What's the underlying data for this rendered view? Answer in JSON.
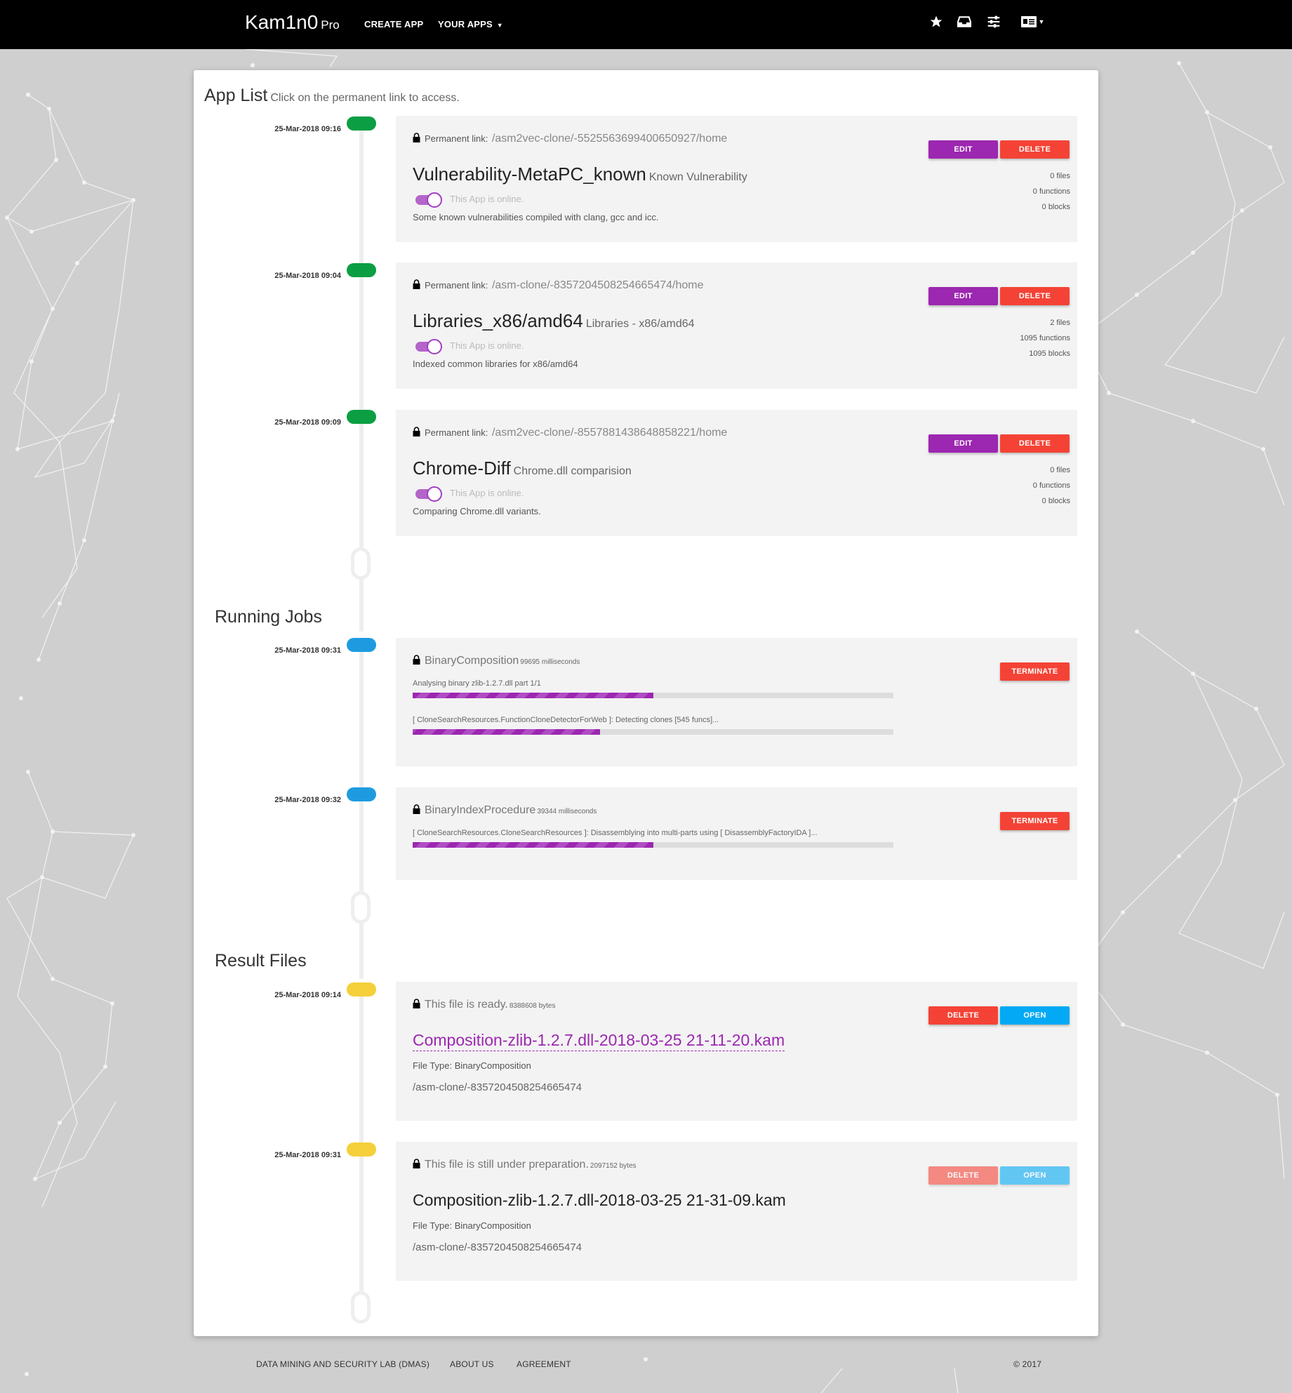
{
  "navbar": {
    "brand": "Kam1n0",
    "brand_suffix": "Pro",
    "create_app": "CREATE APP",
    "your_apps": "YOUR APPS",
    "icons": [
      "star-icon",
      "inbox-icon",
      "sliders-icon",
      "id-card-icon"
    ]
  },
  "app_list": {
    "title": "App List",
    "subtitle": "Click on the permanent link to access.",
    "apps": [
      {
        "timestamp": "25-Mar-2018 09:16",
        "perm_label": "Permanent link:",
        "url": "/asm2vec-clone/-5525563699400650927/home",
        "name": "Vulnerability-MetaPC_known",
        "category": "Known Vulnerability",
        "status": "This App is online.",
        "description": "Some known vulnerabilities compiled with clang, gcc and icc.",
        "files": "0 files",
        "functions": "0 functions",
        "blocks": "0 blocks",
        "edit": "EDIT",
        "delete": "DELETE"
      },
      {
        "timestamp": "25-Mar-2018 09:04",
        "perm_label": "Permanent link:",
        "url": "/asm-clone/-8357204508254665474/home",
        "name": "Libraries_x86/amd64",
        "category": "Libraries - x86/amd64",
        "status": "This App is online.",
        "description": "Indexed common libraries for x86/amd64",
        "files": "2 files",
        "functions": "1095 functions",
        "blocks": "1095 blocks",
        "edit": "EDIT",
        "delete": "DELETE"
      },
      {
        "timestamp": "25-Mar-2018 09:09",
        "perm_label": "Permanent link:",
        "url": "/asm2vec-clone/-8557881438648858221/home",
        "name": "Chrome-Diff",
        "category": "Chrome.dll comparision",
        "status": "This App is online.",
        "description": "Comparing Chrome.dll variants.",
        "files": "0 files",
        "functions": "0 functions",
        "blocks": "0 blocks",
        "edit": "EDIT",
        "delete": "DELETE"
      }
    ]
  },
  "running_jobs": {
    "title": "Running Jobs",
    "jobs": [
      {
        "timestamp": "25-Mar-2018 09:31",
        "name": "BinaryComposition",
        "duration": "99695 milliseconds",
        "terminate": "TERMINATE",
        "progress": [
          {
            "label": "Analysing binary zlib-1.2.7.dll part 1/1",
            "fraction": 0.5
          },
          {
            "label": "[ CloneSearchResources.FunctionCloneDetectorForWeb ]: Detecting clones [545 funcs]...",
            "fraction": 0.39
          }
        ]
      },
      {
        "timestamp": "25-Mar-2018 09:32",
        "name": "BinaryIndexProcedure",
        "duration": "39344 milliseconds",
        "terminate": "TERMINATE",
        "progress": [
          {
            "label": "[ CloneSearchResources.CloneSearchResources ]: Disassemblying into multi-parts using [ DisassemblyFactoryIDA ]...",
            "fraction": 0.5
          }
        ]
      }
    ]
  },
  "result_files": {
    "title": "Result Files",
    "files": [
      {
        "timestamp": "25-Mar-2018 09:14",
        "status": "This file is ready.",
        "bytes": "8388608 bytes",
        "name": "Composition-zlib-1.2.7.dll-2018-03-25 21-11-20.kam",
        "file_type": "File Type: BinaryComposition",
        "path": "/asm-clone/-8357204508254665474",
        "delete": "DELETE",
        "open": "OPEN"
      },
      {
        "timestamp": "25-Mar-2018 09:31",
        "status": "This file is still under preparation.",
        "bytes": "2097152 bytes",
        "name": "Composition-zlib-1.2.7.dll-2018-03-25 21-31-09.kam",
        "file_type": "File Type: BinaryComposition",
        "path": "/asm-clone/-8357204508254665474",
        "delete": "DELETE",
        "open": "OPEN"
      }
    ]
  },
  "footer": {
    "lab": "DATA MINING AND SECURITY LAB (DMAS)",
    "about": "ABOUT US",
    "agreement": "AGREEMENT",
    "copyright": "© 2017"
  },
  "colors": {
    "app_pill": "#0b9e43",
    "job_pill": "#1e9be0",
    "file_pill": "#f5d03a",
    "accent": "#9c27b0",
    "danger": "#f44336",
    "info": "#03a9f4"
  }
}
